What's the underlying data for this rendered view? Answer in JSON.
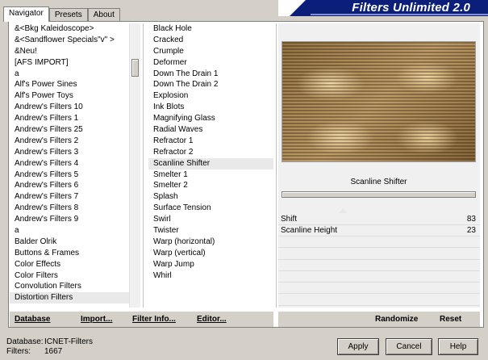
{
  "tabs": [
    "Navigator",
    "Presets",
    "About"
  ],
  "banner_title": "Filters Unlimited 2.0",
  "categories": [
    "&<Bkg Kaleidoscope>",
    "&<Sandflower Specials\"v\" >",
    "&Neu!",
    "[AFS IMPORT]",
    "a",
    "Alf's Power Sines",
    "Alf's Power Toys",
    "Andrew's Filters 10",
    "Andrew's Filters 1",
    "Andrew's Filters 25",
    "Andrew's Filters 2",
    "Andrew's Filters 3",
    "Andrew's Filters 4",
    "Andrew's Filters 5",
    "Andrew's Filters 6",
    "Andrew's Filters 7",
    "Andrew's Filters 8",
    "Andrew's Filters 9",
    "a",
    "Balder Olrik",
    "Buttons & Frames",
    "Color Effects",
    "Color Filters",
    "Convolution Filters",
    "Distortion Filters"
  ],
  "filters": [
    "Black Hole",
    "Cracked",
    "Crumple",
    "Deformer",
    "Down The Drain 1",
    "Down The Drain 2",
    "Explosion",
    "Ink Blots",
    "Magnifying Glass",
    "Radial Waves",
    "Refractor 1",
    "Refractor 2",
    "Scanline Shifter",
    "Smelter 1",
    "Smelter 2",
    "Splash",
    "Surface Tension",
    "Swirl",
    "Twister",
    "Warp (horizontal)",
    "Warp (vertical)",
    "Warp Jump",
    "Whirl"
  ],
  "selected_category": "Distortion Filters",
  "selected_filter": "Scanline Shifter",
  "filter_name": "Scanline Shifter",
  "params": [
    {
      "name": "Shift",
      "value": "83"
    },
    {
      "name": "Scanline Height",
      "value": "23"
    }
  ],
  "links": {
    "database": "Database",
    "import": "Import...",
    "filter_info": "Filter Info...",
    "editor": "Editor...",
    "randomize": "Randomize",
    "reset": "Reset"
  },
  "info": {
    "database_label": "Database:",
    "database_value": "ICNET-Filters",
    "filters_label": "Filters:",
    "filters_value": "1667"
  },
  "buttons": {
    "apply": "Apply",
    "cancel": "Cancel",
    "help": "Help"
  }
}
